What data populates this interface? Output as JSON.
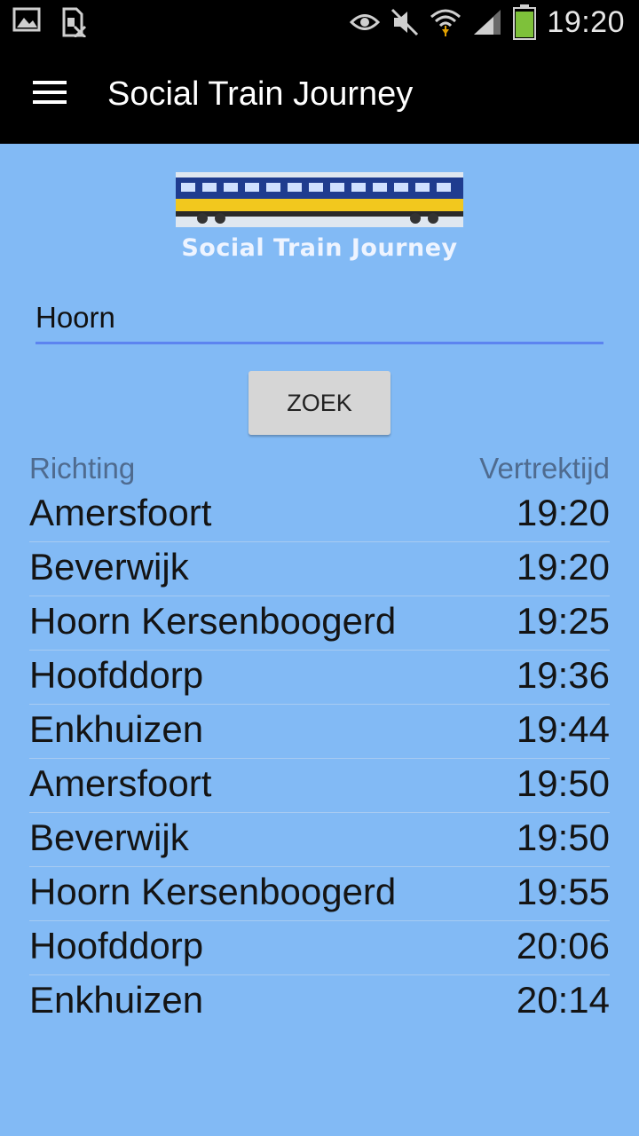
{
  "status_bar": {
    "time": "19:20",
    "icons": [
      "gallery-icon",
      "sim-off-icon",
      "eye-icon",
      "mute-icon",
      "wifi-icon",
      "signal-icon",
      "battery-icon"
    ]
  },
  "app_bar": {
    "title": "Social Train Journey",
    "menu_icon": "hamburger-menu-icon"
  },
  "logo": {
    "text": "Social Train Journey"
  },
  "search": {
    "value": "Hoorn"
  },
  "zoek_button": {
    "label": "ZOEK"
  },
  "table": {
    "headers": {
      "direction": "Richting",
      "departure": "Vertrektijd"
    },
    "rows": [
      {
        "direction": "Amersfoort",
        "time": "19:20"
      },
      {
        "direction": "Beverwijk",
        "time": "19:20"
      },
      {
        "direction": "Hoorn Kersenboogerd",
        "time": "19:25"
      },
      {
        "direction": "Hoofddorp",
        "time": "19:36"
      },
      {
        "direction": "Enkhuizen",
        "time": "19:44"
      },
      {
        "direction": "Amersfoort",
        "time": "19:50"
      },
      {
        "direction": "Beverwijk",
        "time": "19:50"
      },
      {
        "direction": "Hoorn Kersenboogerd",
        "time": "19:55"
      },
      {
        "direction": "Hoofddorp",
        "time": "20:06"
      },
      {
        "direction": "Enkhuizen",
        "time": "20:14"
      }
    ]
  },
  "colors": {
    "background": "#82baf5",
    "app_bar": "#000000",
    "accent": "#5c84f0",
    "button": "#d6d6d6"
  }
}
